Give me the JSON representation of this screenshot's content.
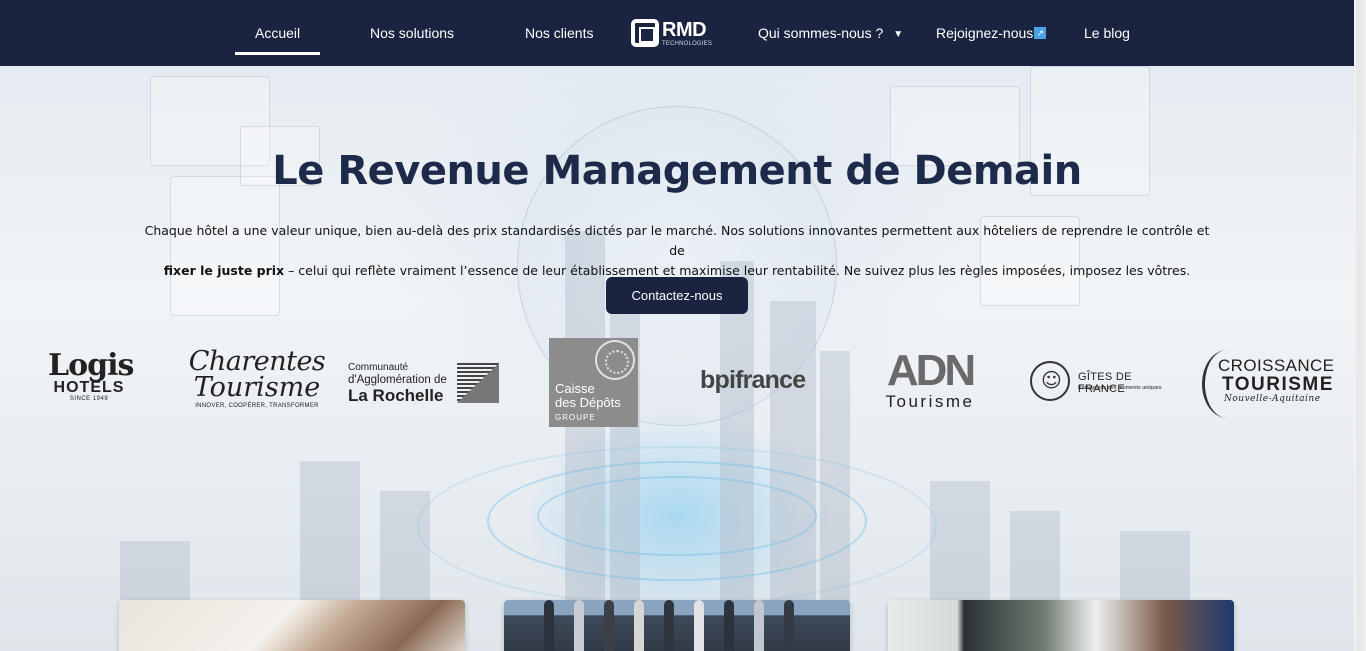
{
  "nav": {
    "items_left": [
      "Accueil",
      "Nos solutions",
      "Nos clients"
    ],
    "logo": {
      "main": "RMD",
      "sub": "TECHNOLOGIES"
    },
    "items_right": [
      "Qui sommes-nous ?",
      "Rejoignez-nous",
      "Le blog"
    ],
    "active": "Accueil",
    "icons": {
      "dropdown": "chevron-down-icon",
      "external": "external-link-icon"
    }
  },
  "hero": {
    "title": "Le Revenue Management de Demain",
    "desc_part1": "Chaque hôtel a une valeur unique, bien au-delà des prix standardisés dictés par le marché. Nos solutions innovantes permettent aux hôteliers de reprendre le contrôle et de",
    "desc_bold": "fixer le juste prix",
    "desc_part2": " – celui qui reflète vraiment l’essence de leur établissement et maximise leur rentabilité. Ne suivez plus les règles imposées, imposez les vôtres.",
    "cta": "Contactez-nous"
  },
  "partners": {
    "logis": {
      "line1": "Logis",
      "line2": "HOTELS",
      "line3": "SINCE 1949"
    },
    "charentes": {
      "line1": "Charentes",
      "line2": "Tourisme",
      "line3": "INNOVER, COOPÉRER, TRANSFORMER"
    },
    "rochelle": {
      "line1": "Communauté",
      "line2": "d'Agglomération de",
      "line3": "La Rochelle"
    },
    "cdc": {
      "line1": "Caisse",
      "line2": "des Dépôts",
      "line3": "GROUPE"
    },
    "bpi": {
      "name": "bpifrance"
    },
    "adn": {
      "line1": "ADN",
      "line2": "Tourisme"
    },
    "gites": {
      "line1": "GÎTES DE FRANCE",
      "line2": "Partageons des moments uniques"
    },
    "croissance": {
      "line1": "CROISSANCE",
      "line2": "TOURISME",
      "line3": "Nouvelle-Aquitaine"
    }
  },
  "colors": {
    "nav_bg": "#1a2340",
    "title": "#1e2a4a",
    "cta_bg": "#1a2340"
  }
}
